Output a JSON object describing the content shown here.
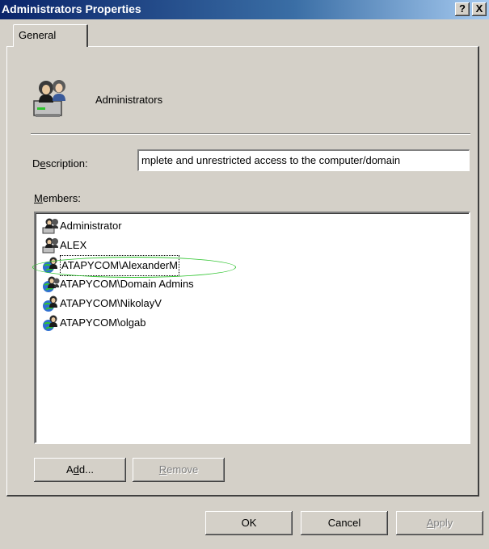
{
  "window": {
    "title": "Administrators Properties",
    "help_button": "?",
    "close_button": "X"
  },
  "tabs": [
    {
      "label": "General",
      "active": true
    }
  ],
  "group": {
    "name": "Administrators",
    "icon": "user-group-icon"
  },
  "description": {
    "label_pre": "D",
    "label_mnemonic": "e",
    "label_post": "scription:",
    "value": "mplete and unrestricted access to the computer/domain"
  },
  "members": {
    "label_mnemonic": "M",
    "label_post": "embers:",
    "items": [
      {
        "name": "Administrator",
        "icon": "user-icon"
      },
      {
        "name": "ALEX",
        "icon": "user-icon"
      },
      {
        "name": "ATAPYCOM\\AlexanderM",
        "icon": "domain-user-icon",
        "focused": true
      },
      {
        "name": "ATAPYCOM\\Domain Admins",
        "icon": "domain-group-icon"
      },
      {
        "name": "ATAPYCOM\\NikolayV",
        "icon": "domain-user-icon"
      },
      {
        "name": "ATAPYCOM\\olgab",
        "icon": "domain-user-icon"
      }
    ]
  },
  "buttons": {
    "add": {
      "pre": "A",
      "mnemonic": "d",
      "post": "d..."
    },
    "remove": {
      "pre": "",
      "mnemonic": "R",
      "post": "emove",
      "disabled": true
    },
    "ok": {
      "label": "OK"
    },
    "cancel": {
      "label": "Cancel"
    },
    "apply": {
      "pre": "",
      "mnemonic": "A",
      "post": "pply",
      "disabled": true
    }
  },
  "colors": {
    "titlebar_start": "#0a246a",
    "face": "#d4d0c8",
    "annotation_ellipse": "#2ec42e"
  }
}
